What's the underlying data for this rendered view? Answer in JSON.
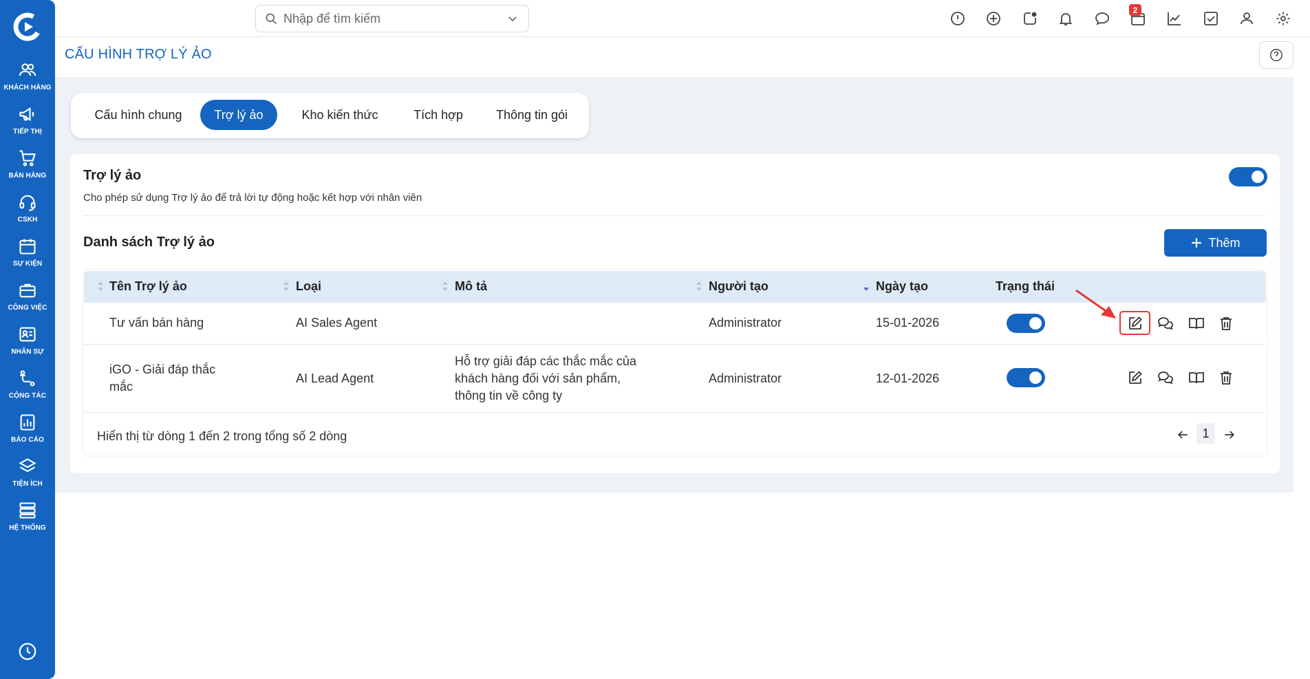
{
  "sidebar": {
    "items": [
      {
        "label": "KHÁCH HÀNG",
        "icon": "users-icon"
      },
      {
        "label": "TIẾP THỊ",
        "icon": "megaphone-icon"
      },
      {
        "label": "BÁN HÀNG",
        "icon": "cart-icon"
      },
      {
        "label": "CSKH",
        "icon": "headset-icon"
      },
      {
        "label": "SỰ KIỆN",
        "icon": "calendar-icon"
      },
      {
        "label": "CÔNG VIỆC",
        "icon": "briefcase-icon"
      },
      {
        "label": "NHÂN SỰ",
        "icon": "id-card-icon"
      },
      {
        "label": "CỘNG TÁC",
        "icon": "workflow-icon"
      },
      {
        "label": "BÁO CÁO",
        "icon": "report-icon"
      },
      {
        "label": "TIỆN ÍCH",
        "icon": "layers-icon"
      },
      {
        "label": "HỆ THỐNG",
        "icon": "server-icon"
      }
    ]
  },
  "search": {
    "placeholder": "Nhập để tìm kiếm"
  },
  "notifications": {
    "count": "2"
  },
  "page": {
    "title": "CẤU HÌNH TRỢ LÝ ẢO"
  },
  "tabs": [
    {
      "label": "Cấu hình chung",
      "active": false
    },
    {
      "label": "Trợ lý ảo",
      "active": true
    },
    {
      "label": "Kho kiến thức",
      "active": false
    },
    {
      "label": "Tích hợp",
      "active": false
    },
    {
      "label": "Thông tin gói",
      "active": false
    }
  ],
  "assistant": {
    "title": "Trợ lý ảo",
    "description": "Cho phép sử dụng Trợ lý ảo để trả lời tự động hoặc kết hợp với nhân viên",
    "enabled": true
  },
  "list": {
    "title": "Danh sách Trợ lý ảo",
    "add_label": "Thêm",
    "columns": [
      "Tên Trợ lý ảo",
      "Loại",
      "Mô tả",
      "Người tạo",
      "Ngày tạo",
      "Trạng thái"
    ],
    "rows": [
      {
        "name_lines": [
          "Tư vấn bán hàng"
        ],
        "type": "AI Sales Agent",
        "desc_lines": [],
        "creator": "Administrator",
        "date": "15-01-2026",
        "active": true
      },
      {
        "name_lines": [
          "iGO - Giải đáp thắc",
          "mắc"
        ],
        "type": "AI Lead Agent",
        "desc_lines": [
          "Hỗ trợ giải đáp các thắc mắc của",
          "khách hàng đối với sản phẩm,",
          "thông tin về công ty"
        ],
        "creator": "Administrator",
        "date": "12-01-2026",
        "active": true
      }
    ],
    "footer": "Hiển thị từ dòng 1 đến 2 trong tổng số 2 dòng",
    "page": "1"
  },
  "colors": {
    "brand": "#1565c0",
    "header_bg": "#deebf7",
    "highlight": "#e53935"
  }
}
